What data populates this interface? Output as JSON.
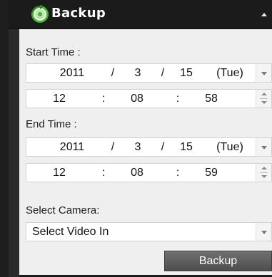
{
  "header": {
    "title": "Backup",
    "icon": "backup-disc-icon",
    "collapse_icon": "chevron-up-icon"
  },
  "start": {
    "label": "Start Time :",
    "date": {
      "year": "2011",
      "sep1": "/",
      "month": "3",
      "sep2": "/",
      "day": "15",
      "weekday": "(Tue)"
    },
    "time": {
      "hour": "12",
      "sep1": ":",
      "minute": "08",
      "sep2": ":",
      "second": "58"
    }
  },
  "end": {
    "label": "End Time :",
    "date": {
      "year": "2011",
      "sep1": "/",
      "month": "3",
      "sep2": "/",
      "day": "15",
      "weekday": "(Tue)"
    },
    "time": {
      "hour": "12",
      "sep1": ":",
      "minute": "08",
      "sep2": ":",
      "second": "59"
    }
  },
  "camera": {
    "label": "Select Camera:",
    "selected": "Select Video In"
  },
  "actions": {
    "backup_label": "Backup"
  },
  "colors": {
    "header_bg": "#1b1b1b",
    "panel_bg": "#efefef",
    "button_bg": "#5e5e5e",
    "icon_green": "#4caf3a"
  }
}
